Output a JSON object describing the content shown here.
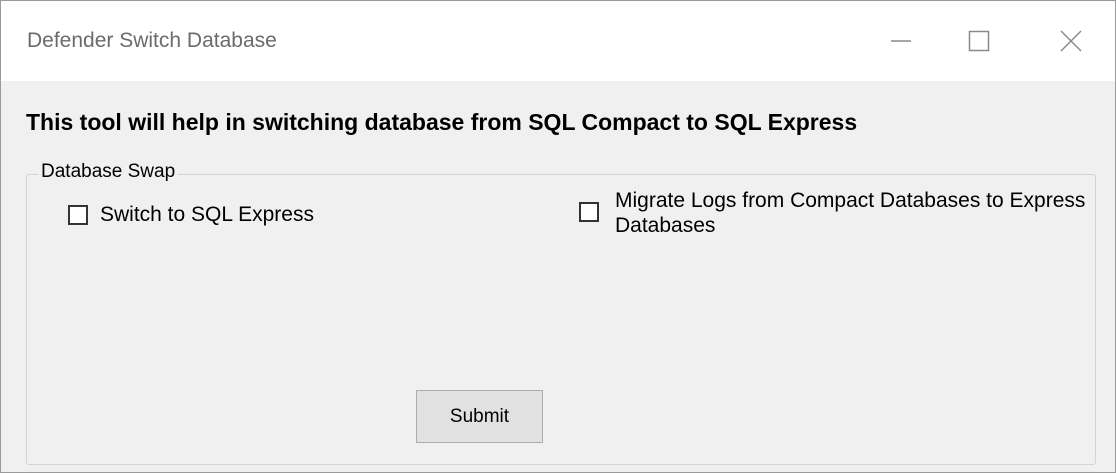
{
  "window": {
    "title": "Defender Switch Database",
    "controls": [
      "minimize-icon",
      "maximize-icon",
      "close-icon"
    ]
  },
  "content": {
    "heading": "This tool will help in switching database from SQL Compact to SQL Express",
    "group": {
      "legend": "Database Swap",
      "options": [
        {
          "label": "Switch to SQL Express",
          "checked": false
        },
        {
          "label": "Migrate Logs from Compact Databases to Express Databases",
          "checked": false
        }
      ],
      "submit_label": "Submit"
    }
  },
  "colors": {
    "window_bg": "#f0f0f0",
    "titlebar_bg": "#ffffff",
    "title_text": "#6b6b6b",
    "button_bg": "#e1e1e1"
  }
}
